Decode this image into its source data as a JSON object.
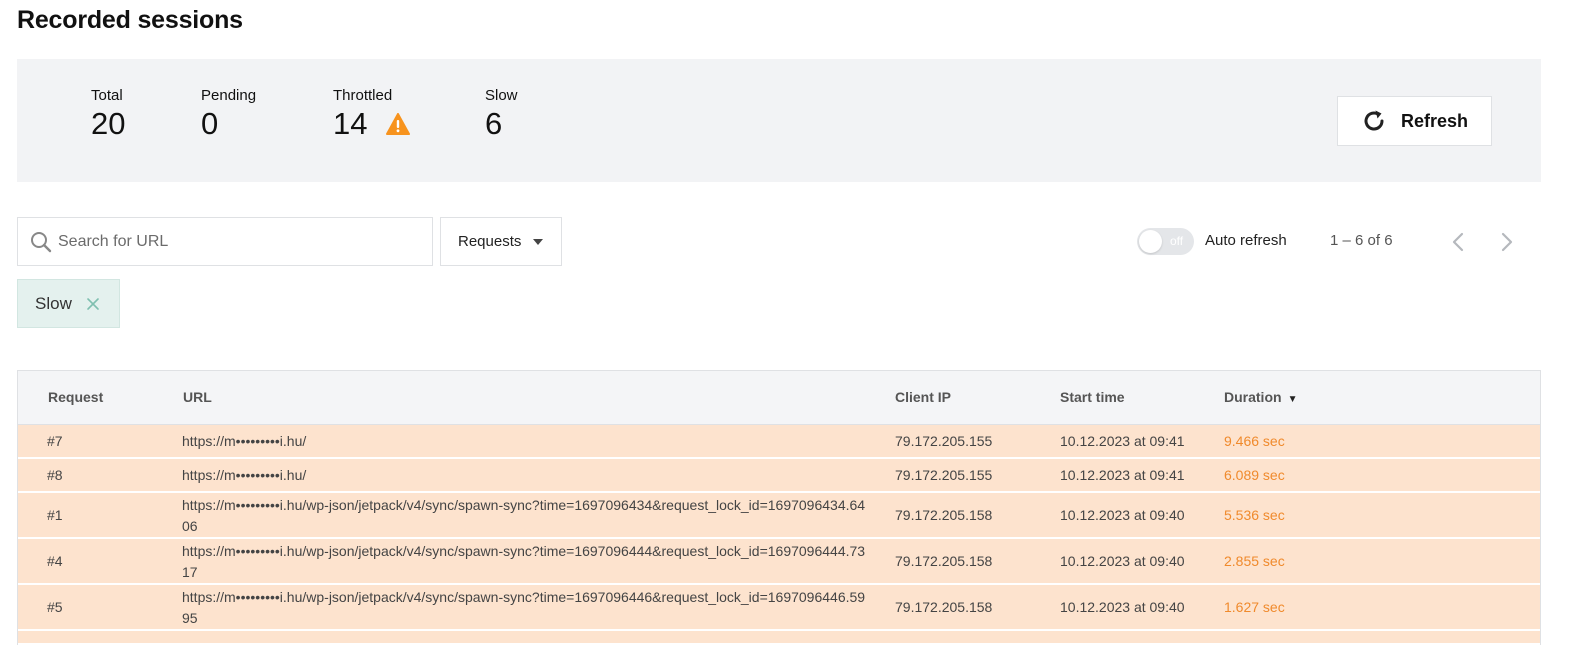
{
  "page": {
    "title": "Recorded sessions"
  },
  "stats": [
    {
      "label": "Total",
      "value": "20"
    },
    {
      "label": "Pending",
      "value": "0"
    },
    {
      "label": "Throttled",
      "value": "14",
      "warning": true
    },
    {
      "label": "Slow",
      "value": "6"
    }
  ],
  "refresh": {
    "label": "Refresh",
    "icon": "refresh-icon"
  },
  "search": {
    "placeholder": "Search for URL",
    "value": ""
  },
  "requests_filter": {
    "label": "Requests"
  },
  "auto_refresh": {
    "toggle_text": "off",
    "label": "Auto refresh",
    "enabled": false
  },
  "pagination": {
    "range": "1 – 6 of 6"
  },
  "active_filter": {
    "label": "Slow"
  },
  "table": {
    "columns": {
      "request": "Request",
      "url": "URL",
      "client_ip": "Client IP",
      "start_time": "Start time",
      "duration": "Duration"
    },
    "rows": [
      {
        "request": "#7",
        "url": "https://m•••••••••i.hu/",
        "client_ip": "79.172.205.155",
        "start_time": "10.12.2023 at 09:41",
        "duration": "9.466 sec"
      },
      {
        "request": "#8",
        "url": "https://m•••••••••i.hu/",
        "client_ip": "79.172.205.155",
        "start_time": "10.12.2023 at 09:41",
        "duration": "6.089 sec"
      },
      {
        "request": "#1",
        "url": "https://m•••••••••i.hu/wp-json/jetpack/v4/sync/spawn-sync?time=1697096434&request_lock_id=1697096434.6406",
        "client_ip": "79.172.205.158",
        "start_time": "10.12.2023 at 09:40",
        "duration": "5.536 sec"
      },
      {
        "request": "#4",
        "url": "https://m•••••••••i.hu/wp-json/jetpack/v4/sync/spawn-sync?time=1697096444&request_lock_id=1697096444.7317",
        "client_ip": "79.172.205.158",
        "start_time": "10.12.2023 at 09:40",
        "duration": "2.855 sec"
      },
      {
        "request": "#5",
        "url": "https://m•••••••••i.hu/wp-json/jetpack/v4/sync/spawn-sync?time=1697096446&request_lock_id=1697096446.5995",
        "client_ip": "79.172.205.158",
        "start_time": "10.12.2023 at 09:40",
        "duration": "1.627 sec"
      }
    ]
  },
  "colors": {
    "panel_bg": "#f2f3f5",
    "warning": "#f7931e",
    "slow_row_bg": "#fde3ce",
    "duration_text": "#f08a2c",
    "chip_bg": "#e4f1ee"
  }
}
